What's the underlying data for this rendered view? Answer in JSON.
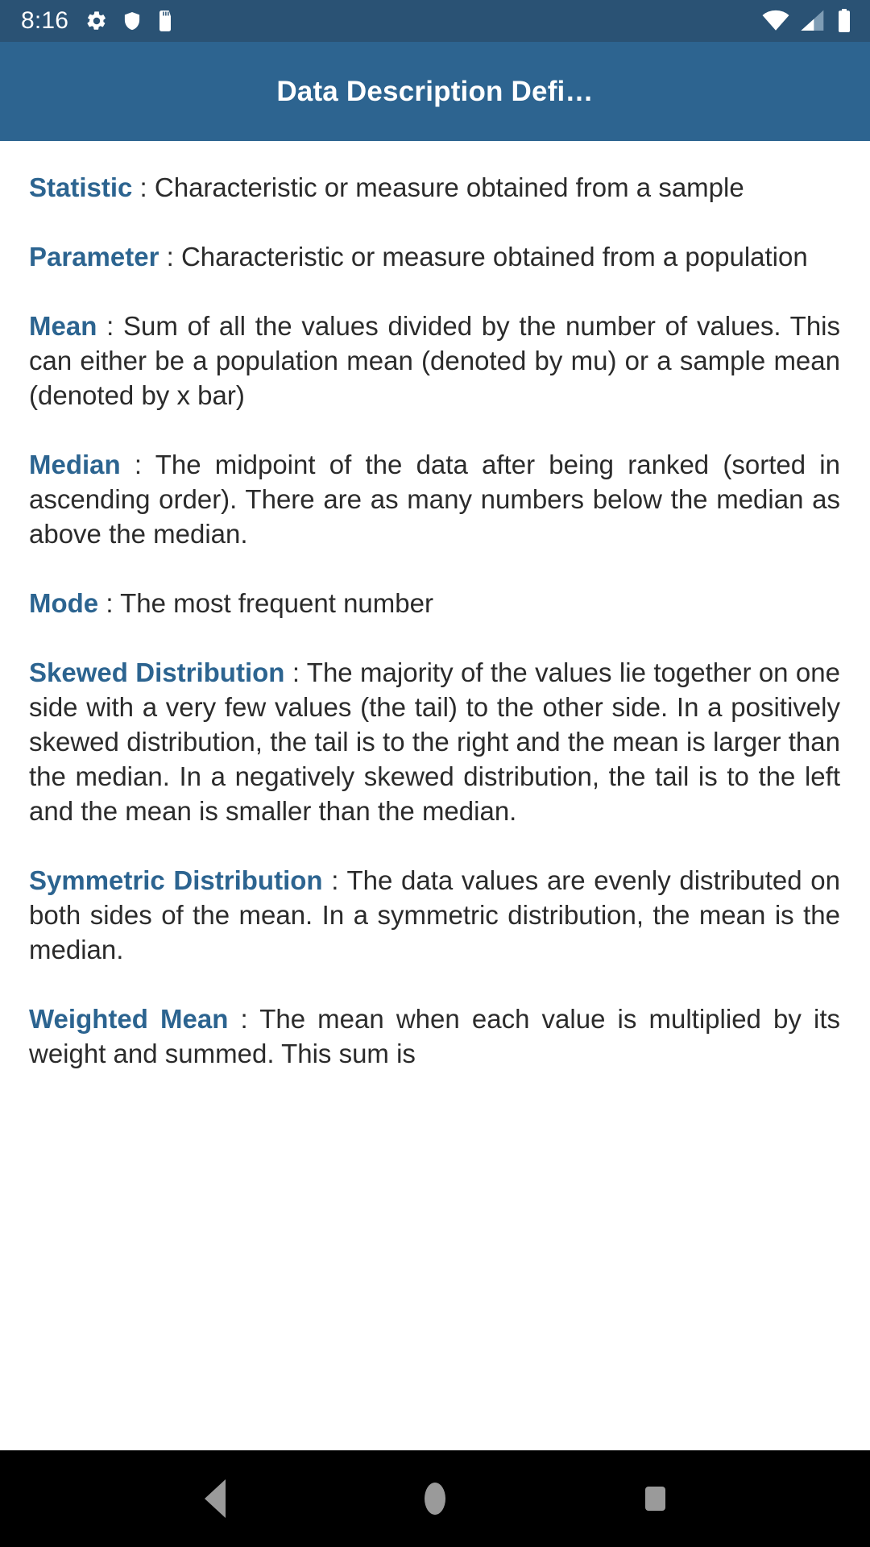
{
  "status_bar": {
    "clock": "8:16",
    "left_icons": [
      "gear-icon",
      "shield-icon",
      "sd-card-icon"
    ],
    "right_icons": [
      "wifi-icon",
      "cell-signal-icon",
      "battery-icon"
    ],
    "background_color": "#2a5274",
    "foreground_color": "#ffffff"
  },
  "app_bar": {
    "title": "Data Description Defi…",
    "background_color": "#2d6490",
    "title_color": "#ffffff"
  },
  "content": {
    "term_color": "#2c6490",
    "body_color": "#2b2b2b",
    "separator": " : ",
    "definitions": [
      {
        "term": "Statistic",
        "body": "Characteristic or measure obtained from a sample"
      },
      {
        "term": "Parameter",
        "body": "Characteristic or measure obtained from a population"
      },
      {
        "term": "Mean",
        "body": "Sum of all the values divided by the number of values. This can either be a population mean (denoted by mu) or a sample mean (denoted by x bar)"
      },
      {
        "term": "Median",
        "body": "The midpoint of the data after being ranked (sorted in ascending order). There are as many numbers below the median as above the median."
      },
      {
        "term": "Mode",
        "body": "The most frequent number"
      },
      {
        "term": "Skewed Distribution",
        "body": "The majority of the values lie together on one side with a very few values (the tail) to the other side. In a positively skewed distribution, the tail is to the right and the mean is larger than the median. In a negatively skewed distribution, the tail is to the left and the mean is smaller than the median."
      },
      {
        "term": "Symmetric Distribution",
        "body": "The data values are evenly distributed on both sides of the mean. In a symmetric distribution, the mean is the median."
      },
      {
        "term": "Weighted Mean",
        "body": "The mean when each value is multiplied by its weight and summed. This sum is"
      }
    ]
  },
  "nav_bar": {
    "background_color": "#000000",
    "icon_color": "#9a9a9a",
    "buttons": [
      {
        "name": "back-button",
        "icon": "triangle-left-icon"
      },
      {
        "name": "home-button",
        "icon": "circle-icon"
      },
      {
        "name": "recents-button",
        "icon": "square-icon"
      }
    ]
  }
}
